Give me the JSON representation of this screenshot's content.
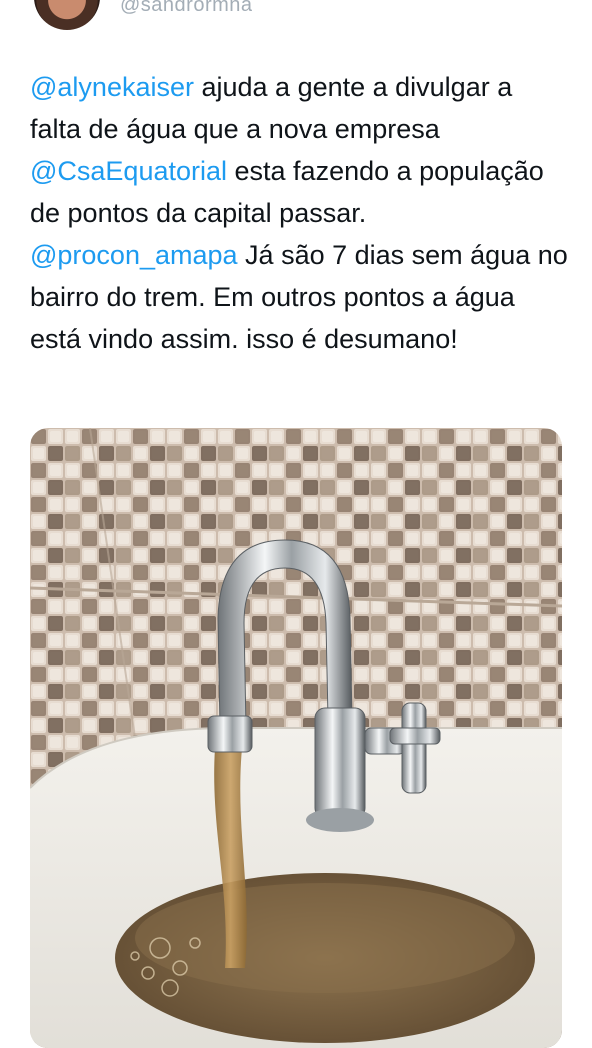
{
  "author": {
    "handle": "@sandrormna"
  },
  "tweet": {
    "segments": [
      {
        "text": "@alynekaiser",
        "type": "mention"
      },
      {
        "text": " ajuda a gente a divulgar a falta de água que a nova empresa ",
        "type": "text"
      },
      {
        "text": "@CsaEquatorial",
        "type": "mention"
      },
      {
        "text": " esta fazendo a população de pontos da capital passar. ",
        "type": "text"
      },
      {
        "text": "@procon_amapa",
        "type": "mention"
      },
      {
        "text": " Já são 7 dias sem água no bairro do trem. Em outros pontos a água está vindo assim. isso é desumano!",
        "type": "text"
      }
    ]
  },
  "media": {
    "photo_subject": "faucet-with-dirty-water"
  },
  "colors": {
    "mention": "#1d9bf0",
    "text": "#0f1419",
    "handle": "#a3adb6"
  }
}
